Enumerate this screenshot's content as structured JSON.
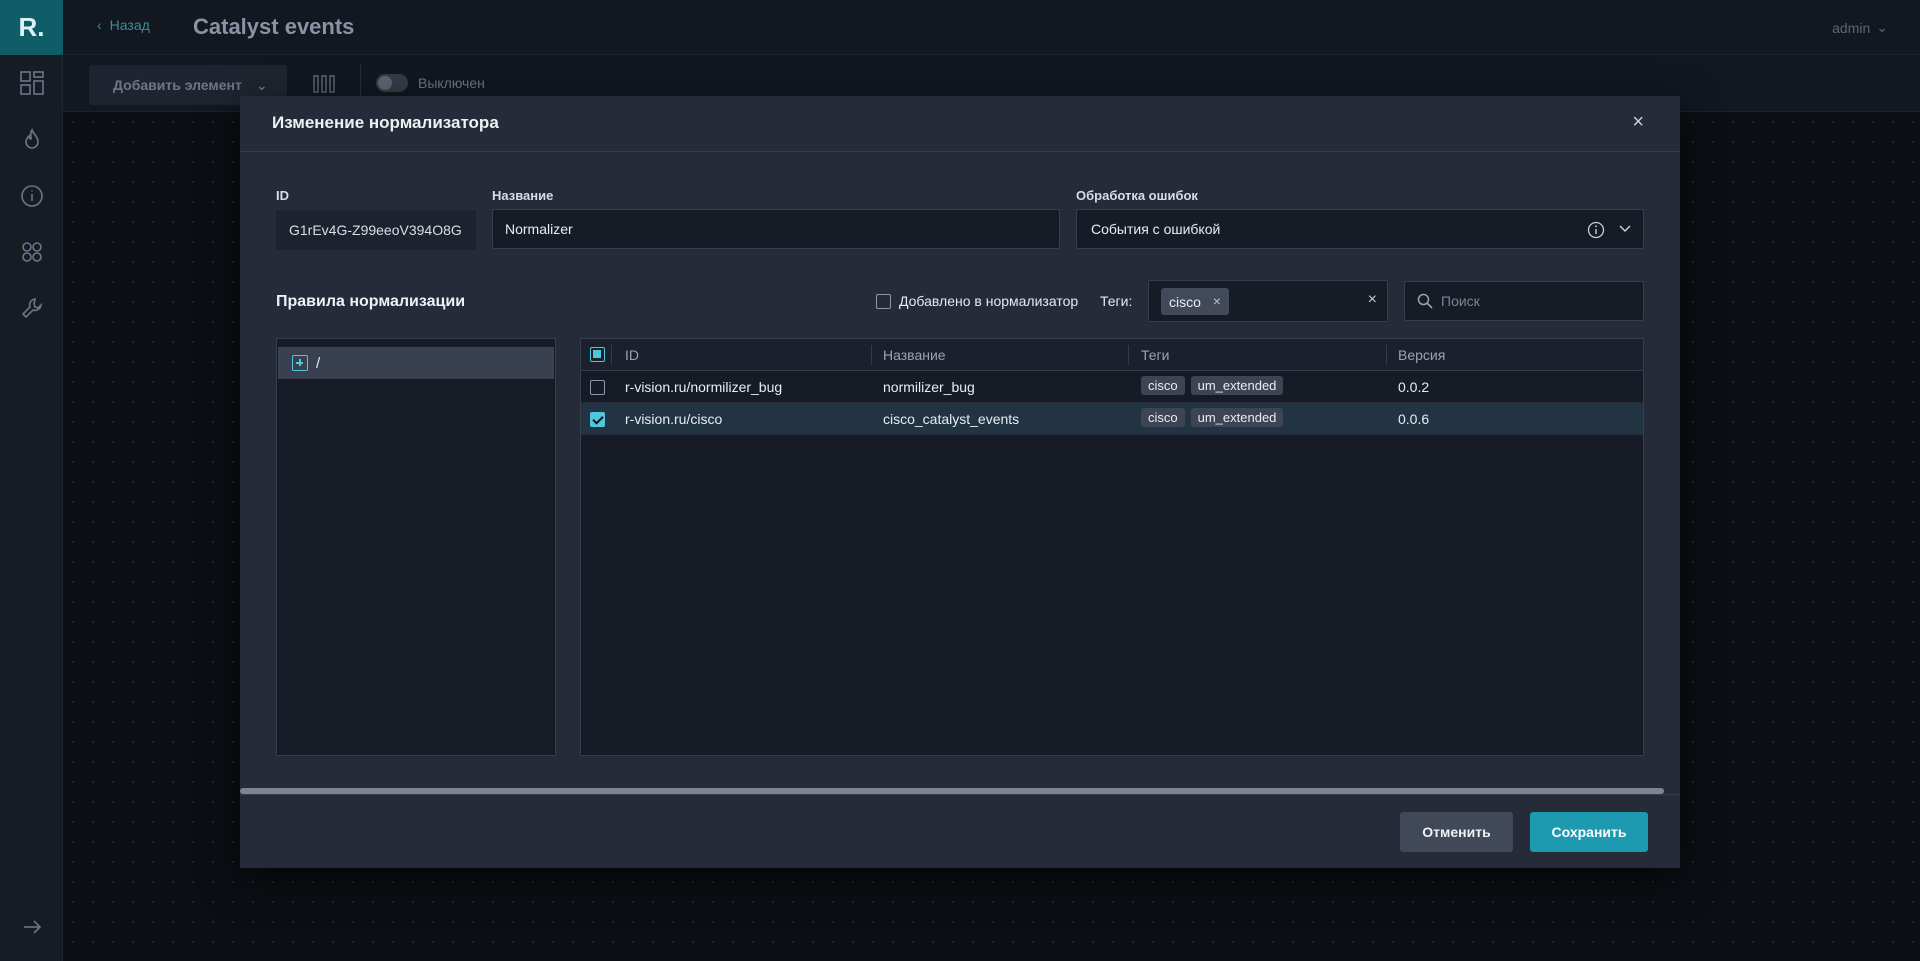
{
  "app": {
    "logo_text": "R.",
    "back_label": "Назад",
    "page_title": "Catalyst events",
    "user": "admin"
  },
  "sidebar": {
    "items": [
      {
        "icon": "dashboard-icon"
      },
      {
        "icon": "flame-icon"
      },
      {
        "icon": "info-icon"
      },
      {
        "icon": "modules-icon"
      },
      {
        "icon": "wrench-icon"
      },
      {
        "icon": "expand-arrow-icon"
      }
    ]
  },
  "toolbar": {
    "add_element_label": "Добавить элемент",
    "toggle_label": "Выключен",
    "toggle_on": false
  },
  "modal": {
    "title": "Изменение нормализатора",
    "fields": {
      "id_label": "ID",
      "id_value": "G1rEv4G-Z99eeoV394O8G",
      "name_label": "Название",
      "name_value": "Normalizer",
      "errors_label": "Обработка ошибок",
      "errors_value": "События с ошибкой"
    },
    "rules_title": "Правила нормализации",
    "filter_added_label": "Добавлено в нормализатор",
    "filter_added_checked": false,
    "tags_label": "Теги:",
    "selected_tags": [
      "cisco"
    ],
    "search_placeholder": "Поиск",
    "tree": {
      "root_label": "/"
    },
    "table": {
      "columns": [
        "ID",
        "Название",
        "Теги",
        "Версия"
      ],
      "rows": [
        {
          "id": "r-vision.ru/normilizer_bug",
          "name": "normilizer_bug",
          "tags": [
            "cisco",
            "um_extended"
          ],
          "version": "0.0.2",
          "checked": false
        },
        {
          "id": "r-vision.ru/cisco",
          "name": "cisco_catalyst_events",
          "tags": [
            "cisco",
            "um_extended"
          ],
          "version": "0.0.6",
          "checked": true
        }
      ]
    },
    "cancel_label": "Отменить",
    "save_label": "Сохранить"
  },
  "colors": {
    "accent": "#1e9ab0",
    "accent_light": "#4fc7dd",
    "logo_bg": "#0f5d66",
    "modal_bg": "#252b38"
  }
}
